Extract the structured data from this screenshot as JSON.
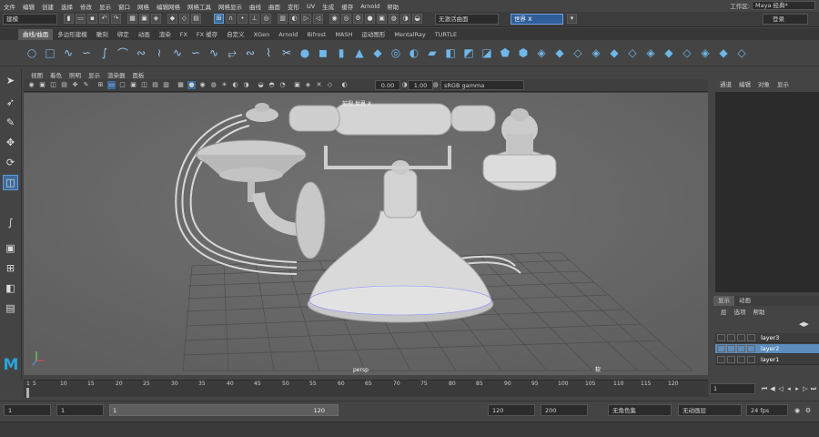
{
  "menubar": {
    "items": [
      "文件",
      "编辑",
      "创建",
      "选择",
      "修改",
      "显示",
      "窗口",
      "网格",
      "编辑网格",
      "网格工具",
      "网格显示",
      "曲线",
      "曲面",
      "变形",
      "UV",
      "生成",
      "缓存",
      "Arnold",
      "帮助"
    ],
    "workspace_label": "工作区:",
    "workspace_value": "Maya 经典*"
  },
  "statusline": {
    "mode": "建模",
    "no_object_field": "无激活曲面",
    "world_field": "世界 X",
    "login": "登录"
  },
  "shelf": {
    "tabs": [
      "曲线/曲面",
      "多边形建模",
      "雕刻",
      "绑定",
      "动画",
      "渲染",
      "FX",
      "FX 缓存",
      "自定义",
      "XGen",
      "Arnold",
      "Bifrost",
      "MASH",
      "运动图形",
      "MentalRay",
      "TURTLE"
    ],
    "active_tab": 0
  },
  "panel": {
    "menu": [
      "视图",
      "着色",
      "照明",
      "显示",
      "渲染器",
      "面板"
    ],
    "exposure": "0.00",
    "gamma": "1.00",
    "color_space": "sRGB gamma",
    "hud_text": "前视 世界 X",
    "camera_name": "persp",
    "center_label": "软"
  },
  "channel_box": {
    "tabs": [
      "通道",
      "编辑",
      "对象",
      "显示"
    ]
  },
  "layers": {
    "tabs": [
      "显示",
      "动画"
    ],
    "active_tab": 0,
    "menu": [
      "层",
      "选项",
      "帮助"
    ],
    "items": [
      {
        "name": "layer3",
        "selected": false
      },
      {
        "name": "layer2",
        "selected": true
      },
      {
        "name": "layer1",
        "selected": false
      }
    ]
  },
  "timeline": {
    "ticks": [
      "1",
      "5",
      "10",
      "15",
      "20",
      "25",
      "30",
      "35",
      "40",
      "45",
      "50",
      "55",
      "60",
      "65",
      "70",
      "75",
      "80",
      "85",
      "90",
      "95",
      "100",
      "105",
      "110",
      "115",
      "120"
    ],
    "current_frame": "1"
  },
  "range": {
    "start_field": "1",
    "start_field2": "1",
    "slider_start": "1",
    "slider_end": "120",
    "end_field": "120",
    "end_field2": "200",
    "character_set": "无角色集",
    "anim_layer": "无动画层",
    "fps": "24 fps"
  },
  "colors": {
    "accent": "#5c8dbd",
    "viewport_bg": "#6b6b6b",
    "maya_logo": "#29a5d9"
  }
}
